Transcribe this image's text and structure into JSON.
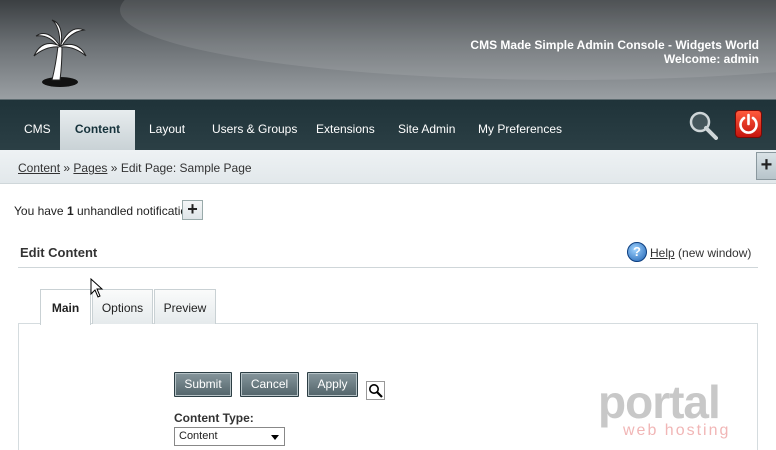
{
  "header": {
    "console_title": "CMS Made Simple Admin Console - Widgets World",
    "welcome": "Welcome: admin"
  },
  "nav": {
    "items": [
      {
        "label": "CMS"
      },
      {
        "label": "Content",
        "active": true
      },
      {
        "label": "Layout"
      },
      {
        "label": "Users & Groups"
      },
      {
        "label": "Extensions"
      },
      {
        "label": "Site Admin"
      },
      {
        "label": "My Preferences"
      }
    ],
    "icons": [
      "search-icon",
      "logout-power-icon"
    ]
  },
  "breadcrumb": {
    "content": "Content",
    "pages": "Pages",
    "current": "Edit Page: Sample Page",
    "separator": "»"
  },
  "notification": {
    "prefix": "You have",
    "count": "1",
    "suffix": "unhandled notification",
    "button": "+"
  },
  "edit": {
    "title": "Edit Content",
    "help_link": "Help",
    "help_suffix": "(new window)"
  },
  "tabs": [
    {
      "label": "Main",
      "active": true
    },
    {
      "label": "Options"
    },
    {
      "label": "Preview"
    }
  ],
  "buttons": {
    "submit": "Submit",
    "cancel": "Cancel",
    "apply": "Apply"
  },
  "content_type": {
    "label": "Content Type:",
    "value": "Content"
  },
  "watermark": {
    "big": "portal",
    "small": "web hosting"
  },
  "side_tab": "+",
  "colors": {
    "nav_bg": "#2b3f45",
    "button_bg": "#52646a",
    "power_red": "#c4140d"
  }
}
